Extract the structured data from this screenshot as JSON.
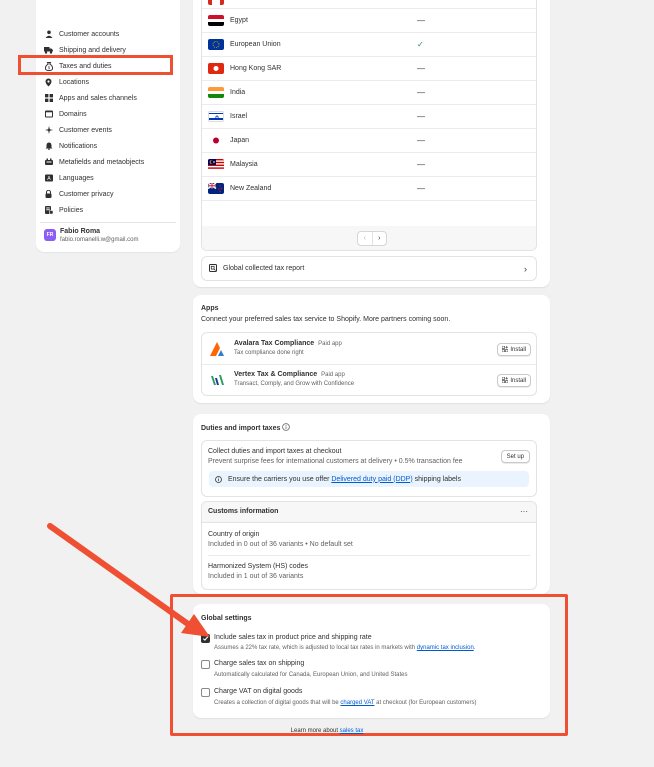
{
  "sidebar": {
    "items": [
      {
        "label": "Customer accounts",
        "icon": "person-icon"
      },
      {
        "label": "Shipping and delivery",
        "icon": "truck-icon"
      },
      {
        "label": "Taxes and duties",
        "icon": "tax-icon",
        "active": true
      },
      {
        "label": "Locations",
        "icon": "location-icon"
      },
      {
        "label": "Apps and sales channels",
        "icon": "apps-icon"
      },
      {
        "label": "Domains",
        "icon": "globe-icon"
      },
      {
        "label": "Customer events",
        "icon": "sparkle-icon"
      },
      {
        "label": "Notifications",
        "icon": "bell-icon"
      },
      {
        "label": "Metafields and metaobjects",
        "icon": "database-icon"
      },
      {
        "label": "Languages",
        "icon": "language-icon"
      },
      {
        "label": "Customer privacy",
        "icon": "lock-icon"
      },
      {
        "label": "Policies",
        "icon": "policy-icon"
      }
    ],
    "user": {
      "initials": "FR",
      "name": "Fabio Roma",
      "email": "fabio.romanelli.w@gmail.com"
    }
  },
  "countries": {
    "rows": [
      {
        "name": "Egypt",
        "value": "—"
      },
      {
        "name": "European Union",
        "value": "✓"
      },
      {
        "name": "Hong Kong SAR",
        "value": "—"
      },
      {
        "name": "India",
        "value": "—"
      },
      {
        "name": "Israel",
        "value": "—"
      },
      {
        "name": "Japan",
        "value": "—"
      },
      {
        "name": "Malaysia",
        "value": "—"
      },
      {
        "name": "New Zealand",
        "value": "—"
      }
    ],
    "pager_prev": "‹",
    "pager_next": "›",
    "report_label": "Global collected tax report",
    "report_chevron": "›"
  },
  "apps": {
    "title": "Apps",
    "subtitle": "Connect your preferred sales tax service to Shopify. More partners coming soon.",
    "items": [
      {
        "name": "Avalara Tax Compliance",
        "badge": "Paid app",
        "description": "Tax compliance done right",
        "button": "Install"
      },
      {
        "name": "Vertex Tax & Compliance",
        "badge": "Paid app",
        "description": "Transact, Comply, and Grow with Confidence",
        "button": "Install"
      }
    ]
  },
  "duties": {
    "title": "Duties and import taxes",
    "collect_title": "Collect duties and import taxes at checkout",
    "collect_desc": "Prevent surprise fees for international customers at delivery • 0.5% transaction fee",
    "setup_button": "Set up",
    "banner_prefix": "Ensure the carriers you use offer ",
    "banner_link": "Delivered duty paid (DDP)",
    "banner_suffix": " shipping labels",
    "customs_title": "Customs information",
    "customs_more": "···",
    "origin_title": "Country of origin",
    "origin_desc": "Included in 0 out of 36 variants • No default set",
    "hs_title": "Harmonized System (HS) codes",
    "hs_desc": "Included in 1 out of 36 variants"
  },
  "global": {
    "title": "Global settings",
    "options": [
      {
        "label": "Include sales tax in product price and shipping rate",
        "help_prefix": "Assumes a 22% tax rate, which is adjusted to local tax rates in markets with ",
        "help_link": "dynamic tax inclusion",
        "help_suffix": ".",
        "checked": true
      },
      {
        "label": "Charge sales tax on shipping",
        "help_prefix": "Automatically calculated for Canada, European Union, and United States",
        "help_link": "",
        "help_suffix": "",
        "checked": false
      },
      {
        "label": "Charge VAT on digital goods",
        "help_prefix": "Creates a collection of digital goods that will be ",
        "help_link": "charged VAT",
        "help_suffix": " at checkout (for European customers)",
        "checked": false
      }
    ]
  },
  "footer": {
    "learn_prefix": "Learn more about ",
    "learn_link": "sales tax"
  },
  "colors": {
    "accent_annotation": "#ef4f32",
    "link": "#005bd3",
    "check": "#2e8b57"
  }
}
